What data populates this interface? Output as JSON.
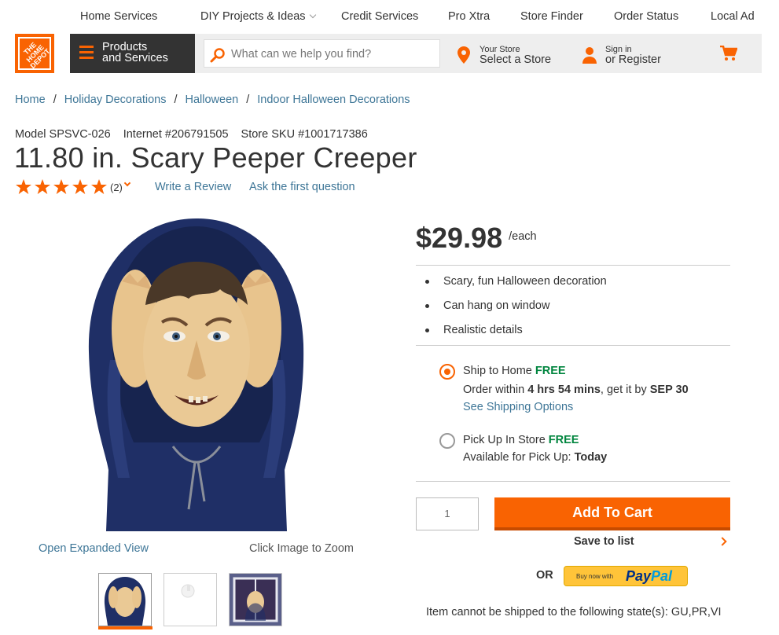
{
  "topnav": {
    "items": [
      "Home Services",
      "DIY Projects & Ideas",
      "Credit Services",
      "Pro Xtra",
      "Store Finder",
      "Order Status",
      "Local Ad"
    ]
  },
  "header": {
    "logo_text": "THE HOME DEPOT",
    "products_label_1": "Products",
    "products_label_2": "and Services",
    "search_placeholder": "What can we help you find?",
    "store_small": "Your Store",
    "store_big": "Select a Store",
    "signin_small": "Sign in",
    "signin_big": "or Register"
  },
  "breadcrumb": [
    "Home",
    "Holiday Decorations",
    "Halloween",
    "Indoor Halloween Decorations"
  ],
  "product": {
    "model": "Model SPSVC-026",
    "internet": "Internet #206791505",
    "sku": "Store SKU #1001717386",
    "title": "11.80 in. Scary Peeper Creeper",
    "rating_stars": 5,
    "rating_count": "(2)",
    "write_review": "Write a Review",
    "ask_question": "Ask the first question",
    "open_expanded": "Open Expanded View",
    "click_zoom": "Click Image to Zoom"
  },
  "pricing": {
    "price": "$29.98",
    "unit": "/each",
    "bullets": [
      "Scary, fun Halloween decoration",
      "Can hang on window",
      "Realistic details"
    ]
  },
  "fulfillment": {
    "ship_label": "Ship to Home",
    "ship_free": "FREE",
    "order_within_prefix": "Order within",
    "order_time": "4 hrs 54 mins",
    "get_it_by": ", get it by",
    "date": "SEP 30",
    "shipping_options": "See Shipping Options",
    "pickup_label": "Pick Up In Store",
    "pickup_free": "FREE",
    "pickup_available": "Available for Pick Up:",
    "pickup_when": "Today"
  },
  "cart": {
    "quantity": "1",
    "add_to_cart": "Add To Cart",
    "save_to_list": "Save to list",
    "or": "OR",
    "paypal_small": "Buy now with",
    "paypal_pay": "Pay",
    "paypal_pal": "Pal",
    "ship_restriction": "Item cannot be shipped to the following state(s): GU,PR,VI"
  },
  "colors": {
    "brand_orange": "#f96302",
    "link_blue": "#3e7697",
    "free_green": "#00853e"
  }
}
